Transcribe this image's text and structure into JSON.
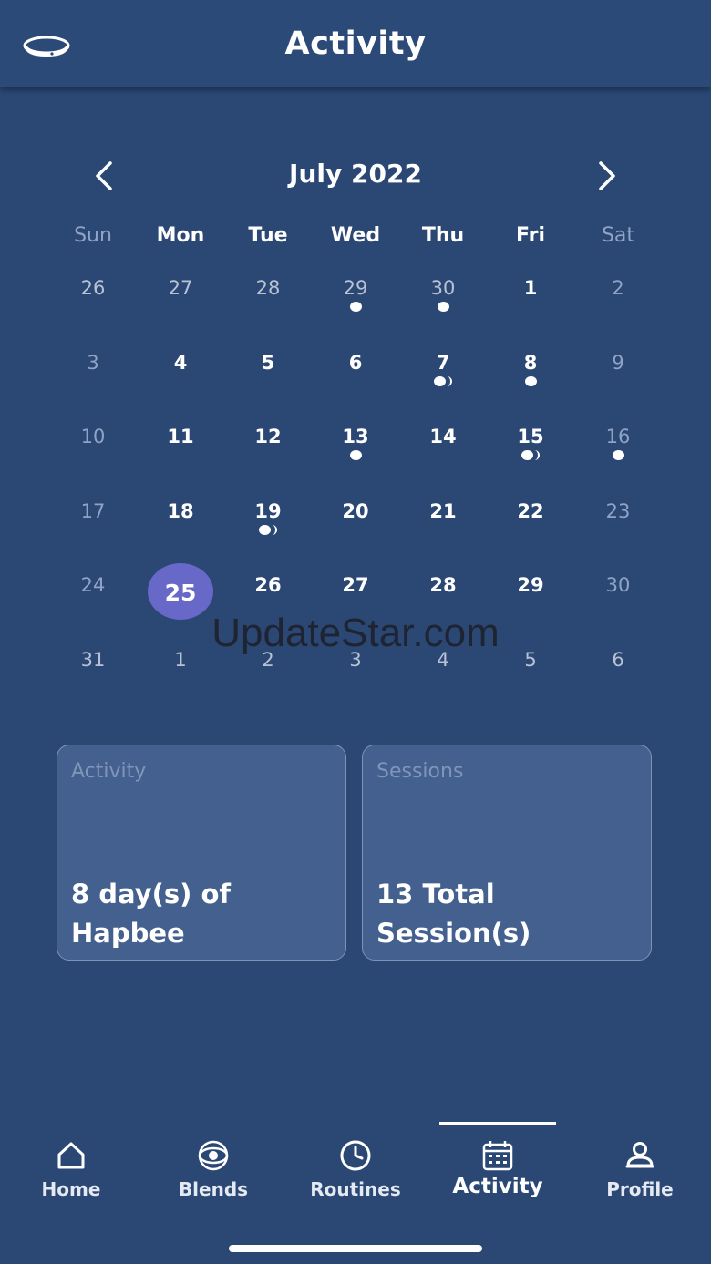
{
  "header": {
    "title": "Activity",
    "device_icon": "band-icon"
  },
  "calendar": {
    "month_label": "July 2022",
    "prev_icon": "chevron-left-icon",
    "next_icon": "chevron-right-icon",
    "weekdays": [
      "Sun",
      "Mon",
      "Tue",
      "Wed",
      "Thu",
      "Fri",
      "Sat"
    ],
    "selected_day": "25",
    "selected_color": "#6768c7",
    "weeks": [
      [
        {
          "n": "26",
          "s": "muted"
        },
        {
          "n": "27",
          "s": "muted"
        },
        {
          "n": "28",
          "s": "muted"
        },
        {
          "n": "29",
          "s": "muted",
          "d": "single"
        },
        {
          "n": "30",
          "s": "muted",
          "d": "single"
        },
        {
          "n": "1",
          "s": "current"
        },
        {
          "n": "2",
          "s": "weekend"
        }
      ],
      [
        {
          "n": "3",
          "s": "weekend"
        },
        {
          "n": "4",
          "s": "current"
        },
        {
          "n": "5",
          "s": "current"
        },
        {
          "n": "6",
          "s": "current"
        },
        {
          "n": "7",
          "s": "current",
          "d": "double"
        },
        {
          "n": "8",
          "s": "current",
          "d": "single"
        },
        {
          "n": "9",
          "s": "weekend"
        }
      ],
      [
        {
          "n": "10",
          "s": "weekend"
        },
        {
          "n": "11",
          "s": "current"
        },
        {
          "n": "12",
          "s": "current"
        },
        {
          "n": "13",
          "s": "current",
          "d": "single"
        },
        {
          "n": "14",
          "s": "current"
        },
        {
          "n": "15",
          "s": "current",
          "d": "double"
        },
        {
          "n": "16",
          "s": "weekend",
          "d": "single"
        }
      ],
      [
        {
          "n": "17",
          "s": "weekend"
        },
        {
          "n": "18",
          "s": "current"
        },
        {
          "n": "19",
          "s": "current",
          "d": "double"
        },
        {
          "n": "20",
          "s": "current"
        },
        {
          "n": "21",
          "s": "current"
        },
        {
          "n": "22",
          "s": "current"
        },
        {
          "n": "23",
          "s": "weekend"
        }
      ],
      [
        {
          "n": "24",
          "s": "weekend"
        },
        {
          "n": "25",
          "s": "selected"
        },
        {
          "n": "26",
          "s": "current"
        },
        {
          "n": "27",
          "s": "current"
        },
        {
          "n": "28",
          "s": "current"
        },
        {
          "n": "29",
          "s": "current"
        },
        {
          "n": "30",
          "s": "weekend"
        }
      ],
      [
        {
          "n": "31",
          "s": "muted"
        },
        {
          "n": "1",
          "s": "muted"
        },
        {
          "n": "2",
          "s": "muted"
        },
        {
          "n": "3",
          "s": "muted"
        },
        {
          "n": "4",
          "s": "muted"
        },
        {
          "n": "5",
          "s": "muted"
        },
        {
          "n": "6",
          "s": "muted"
        }
      ]
    ]
  },
  "watermark": "UpdateStar.com",
  "cards": {
    "activity": {
      "label": "Activity",
      "value": "8 day(s) of Hapbee"
    },
    "sessions": {
      "label": "Sessions",
      "value": "13 Total Session(s)"
    }
  },
  "tabs": [
    {
      "label": "Home",
      "icon": "home-icon"
    },
    {
      "label": "Blends",
      "icon": "blends-icon"
    },
    {
      "label": "Routines",
      "icon": "clock-icon"
    },
    {
      "label": "Activity",
      "icon": "calendar-icon",
      "active": true
    },
    {
      "label": "Profile",
      "icon": "profile-icon"
    }
  ],
  "colors": {
    "background": "#2b4875",
    "card": "#44608f",
    "accent": "#6768c7"
  }
}
